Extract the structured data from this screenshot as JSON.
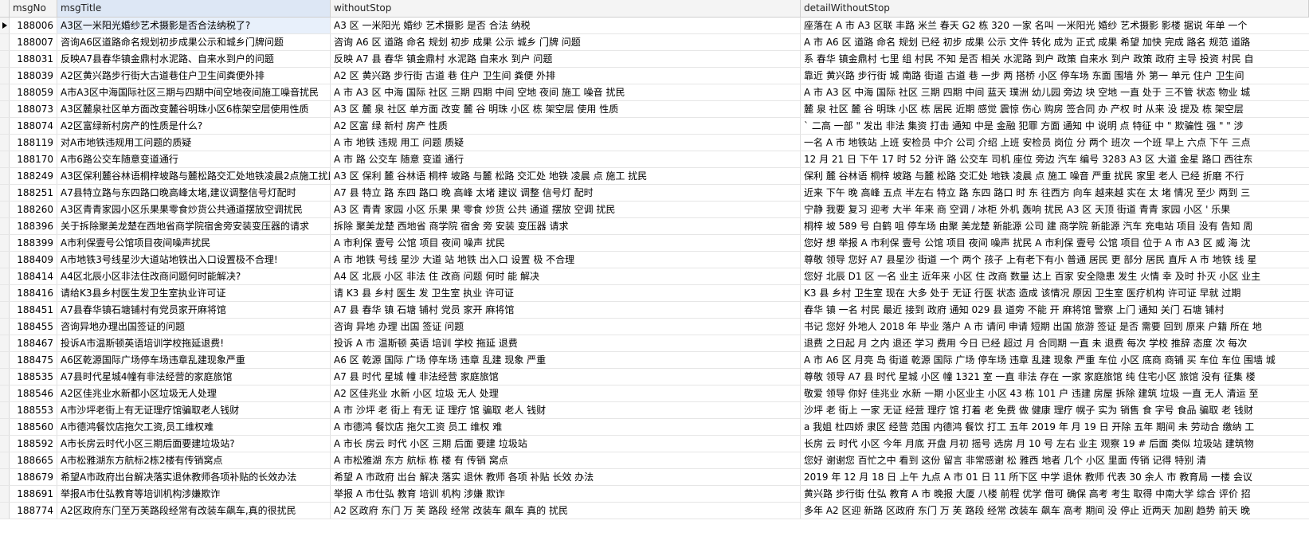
{
  "columns": [
    "msgNo",
    "msgTitle",
    "withoutStop",
    "detailWithoutStop"
  ],
  "rows": [
    {
      "no": "188006",
      "title": "A3区一米阳光婚纱艺术摄影是否合法纳税了?",
      "ws": "A3 区 一米阳光 婚纱 艺术摄影 是否 合法 纳税",
      "detail": "座落在 A 市 A3 区联 丰路 米兰 春天 G2 栋 320 一家 名叫 一米阳光 婚纱 艺术摄影 影楼 据说 年单 一个"
    },
    {
      "no": "188007",
      "title": "咨询A6区道路命名规划初步成果公示和城乡门牌问题",
      "ws": "咨询 A6 区 道路 命名 规划 初步 成果 公示 城乡 门牌 问题",
      "detail": "A 市 A6 区 道路 命名 规划 已经 初步 成果 公示 文件 转化 成为 正式 成果 希望 加快 完成 路名 规范 道路"
    },
    {
      "no": "188031",
      "title": "反映A7县春华镇金鼎村水泥路、自来水到户的问题",
      "ws": "反映 A7 县 春华 镇金鼎村 水泥路 自来水 到户 问题",
      "detail": "系 春华 镇金鼎村 七里 组 村民 不知 是否 相关 水泥路 到户 政策 自来水 到户 政策 政府 主导 投资 村民 自"
    },
    {
      "no": "188039",
      "title": "A2区黄兴路步行街大古道巷住户卫生间粪便外排",
      "ws": "A2 区 黄兴路 步行街 古道 巷 住户 卫生间 粪便 外排",
      "detail": "靠近 黄兴路 步行街 城 南路 街道 古道 巷 一步 两 搭桥 小区 停车场 东面 围墙 外 第一 单元 住户 卫生间"
    },
    {
      "no": "188059",
      "title": "A市A3区中海国际社区三期与四期中间空地夜间施工噪音扰民",
      "ws": "A 市 A3 区 中海 国际 社区 三期 四期 中间 空地 夜间 施工 噪音 扰民",
      "detail": "A 市 A3 区 中海 国际 社区 三期 四期 中间 蓝天 璞洲 幼儿园 旁边 块 空地 一直 处于 三不管 状态 物业 城"
    },
    {
      "no": "188073",
      "title": "A3区麓泉社区单方面改变麓谷明珠小区6栋架空层使用性质",
      "ws": "A3 区 麓 泉 社区 单方面 改变 麓 谷 明珠 小区 栋 架空层 使用 性质",
      "detail": "麓 泉 社区 麓 谷 明珠 小区 栋 居民 近期 感觉 震惊 伤心 购房 签合同 办 产权 时 从来 没 提及 栋 架空层"
    },
    {
      "no": "188074",
      "title": "A2区富绿新村房产的性质是什么?",
      "ws": "A2 区富 绿 新村 房产 性质",
      "detail": "` 二高 一部 \" 发出 非法 集资 打击 通知 中是 金融 犯罪 方面 通知 中 说明 点 特征 中 \" 欺骗性 强 \" \" 涉"
    },
    {
      "no": "188119",
      "title": "对A市地铁违规用工问题的质疑",
      "ws": "A 市 地铁 违规 用工 问题 质疑",
      "detail": "一名 A 市 地铁站 上班 安检员 中介 公司 介绍 上班 安检员 岗位 分 两个 班次 一个班 早上 六点 下午 三点"
    },
    {
      "no": "188170",
      "title": "A市6路公交车随意变道通行",
      "ws": "A 市 路 公交车 随意 变道 通行",
      "detail": "12 月 21 日 下午 17 时 52 分许 路 公交车 司机 座位 旁边 汽车 编号 3283 A3 区 大道 金星 路口 西往东"
    },
    {
      "no": "188249",
      "title": "A3区保利麓谷林语桐梓坡路与麓松路交汇处地铁凌晨2点施工扰民",
      "ws": "A3 区 保利 麓 谷林语 桐梓 坡路 与麓 松路 交汇处 地铁 凌晨 点 施工 扰民",
      "detail": "保利 麓 谷林语 桐梓 坡路 与麓 松路 交汇处 地铁 凌晨 点 施工 噪音 严重 扰民 家里 老人 已经 折磨 不行"
    },
    {
      "no": "188251",
      "title": "A7县特立路与东四路口晚高峰太堵,建议调整信号灯配时",
      "ws": "A7 县 特立 路 东四 路口 晚 高峰 太堵 建议 调整 信号灯 配时",
      "detail": "近来 下午 晚 高峰 五点 半左右 特立 路 东四 路口 时 东 往西方 向车 越来越 实在 太 堵 情况 至少 两到 三"
    },
    {
      "no": "188260",
      "title": "A3区青青家园小区乐果果零食炒货公共通道摆放空调扰民",
      "ws": "A3 区 青青 家园 小区 乐果 果 零食 炒货 公共 通道 摆放 空调 扰民",
      "detail": "宁静 我要 复习 迎考 大半 年来 商 空调 / 冰柜 外机 轰响 扰民 A3 区 天顶 街道 青青 家园 小区 ' 乐果"
    },
    {
      "no": "188396",
      "title": "关于拆除聚美龙楚在西地省商学院宿舍旁安装变压器的请求",
      "ws": "拆除 聚美龙楚 西地省 商学院 宿舍 旁 安装 变压器 请求",
      "detail": "桐梓 坡 589 号 白鹤 咀 停车场 由聚 美龙楚 新能源 公司 建 商学院 新能源 汽车 充电站 项目 没有 告知 周"
    },
    {
      "no": "188399",
      "title": "A市利保壹号公馆项目夜间噪声扰民",
      "ws": "A 市利保 壹号 公馆 项目 夜间 噪声 扰民",
      "detail": "您好 想 举报 A 市利保 壹号 公馆 项目 夜间 噪声 扰民 A 市利保 壹号 公馆 项目 位于 A 市 A3 区 威 海 沈"
    },
    {
      "no": "188409",
      "title": "A市地铁3号线星沙大道站地铁出入口设置极不合理!",
      "ws": "A 市 地铁 号线 星沙 大道 站 地铁 出入口 设置 极 不合理",
      "detail": "尊敬 领导 您好 A7 县星沙 街道 一个 两个 孩子 上有老下有小 普通 居民 更 部分 居民 直斥 A 市 地铁 线 星"
    },
    {
      "no": "188414",
      "title": "A4区北辰小区非法住改商问题何时能解决?",
      "ws": "A4 区 北辰 小区 非法 住 改商 问题 何时 能 解决",
      "detail": "您好 北辰 D1 区 一名 业主 近年来 小区 住 改商 数量 达上 百家 安全隐患 发生 火情 幸 及时 扑灭 小区 业主"
    },
    {
      "no": "188416",
      "title": "请给K3县乡村医生发卫生室执业许可证",
      "ws": "请 K3 县 乡村 医生 发 卫生室 执业 许可证",
      "detail": "K3 县 乡村 卫生室 现在 大多 处于 无证 行医 状态 造成 该情况 原因 卫生室 医疗机构 许可证 早就 过期"
    },
    {
      "no": "188451",
      "title": "A7县春华镇石塘铺村有党员家开麻将馆",
      "ws": "A7 县 春华 镇 石塘 铺村 党员 家开 麻将馆",
      "detail": "春华 镇 一名 村民 最近 接到 政府 通知 029 县 道旁 不能 开 麻将馆 警察 上门 通知 关门 石塘 铺村"
    },
    {
      "no": "188455",
      "title": "咨询异地办理出国签证的问题",
      "ws": "咨询 异地 办理 出国 签证 问题",
      "detail": "书记 您好 外地人 2018 年 毕业 落户 A 市 请问 申请 短期 出国 旅游 签证 是否 需要 回到 原来 户籍 所在 地"
    },
    {
      "no": "188467",
      "title": "投诉A市温斯顿英语培训学校拖延退费!",
      "ws": "投诉 A 市 温斯顿 英语 培训 学校 拖延 退费",
      "detail": "退费 之日起 月 之内 退还 学习 费用 今日 已经 超过 月 合同期 一直 未 退费 每次 学校 推辞 态度 次 每次"
    },
    {
      "no": "188475",
      "title": "A6区乾源国际广场停车场违章乱建现象严重",
      "ws": "A6 区 乾源 国际 广场 停车场 违章 乱建 现象 严重",
      "detail": "A 市 A6 区 月亮 岛 街道 乾源 国际 广场 停车场 违章 乱建 现象 严重 车位 小区 底商 商铺 买 车位 车位 围墙 城"
    },
    {
      "no": "188535",
      "title": "A7县时代星城4幢有非法经营的家庭旅馆",
      "ws": "A7 县 时代 星城 幢 非法经营 家庭旅馆",
      "detail": "尊敬 领导 A7 县 时代 星城 小区 幢 1321 室 一直 非法 存在 一家 家庭旅馆 纯 住宅小区 旅馆 没有 征集 楼"
    },
    {
      "no": "188546",
      "title": "A2区佳兆业水新都小区垃圾无人处理",
      "ws": "A2 区佳兆业 水新 小区 垃圾 无人 处理",
      "detail": "敬爱 领导 你好 佳兆业 水新 一期 小区业主 小区 43 栋 101 户 违建 房屋 拆除 建筑 垃圾 一直 无人 清运 至"
    },
    {
      "no": "188553",
      "title": "A市沙坪老街上有无证理疗馆骗取老人钱财",
      "ws": "A 市 沙坪 老 街上 有无 证 理疗 馆 骗取 老人 钱财",
      "detail": "沙坪 老 街上 一家 无证 经营 理疗 馆 打着 老 免费 做 健康 理疗 幌子 实为 销售 食 字号 食品 骗取 老 钱财"
    },
    {
      "no": "188560",
      "title": "A市德鸿餐饮店拖欠工资,员工维权难",
      "ws": "A 市德鸿 餐饮店 拖欠工资 员工 维权 难",
      "detail": "a 我姐 杜四娇 隶区 经营 范围 内德鸿 餐饮 打工 五年 2019 年 月 19 日 开除 五年 期间 未 劳动合 缴纳 工"
    },
    {
      "no": "188592",
      "title": "A市长房云时代小区三期后面要建垃圾站?",
      "ws": "A 市长 房云 时代 小区 三期 后面 要建 垃圾站",
      "detail": "长房 云 时代 小区 今年 月底 开盘 月初 摇号 选房 月 10 号 左右 业主 观察 19 # 后面 类似 垃圾站 建筑物"
    },
    {
      "no": "188665",
      "title": "A市松雅湖东方航标2栋2楼有传销窝点",
      "ws": "A 市松雅湖 东方 航标 栋 楼 有 传销 窝点",
      "detail": "您好   谢谢您 百忙之中 看到 这份 留言   非常感谢      松 雅西 地者 几个 小区 里面 传销   记得 特别 清"
    },
    {
      "no": "188679",
      "title": "希望A市政府出台解决落实退休教师各项补贴的长效办法",
      "ws": "希望 A 市政府 出台 解决 落实 退休 教师 各项 补贴 长效 办法",
      "detail": "2019 年 12 月 18 日 上午 九点 A 市 01 日 11 所下区 中学 退休 教师 代表 30 余人 市 教育局 一楼 会议"
    },
    {
      "no": "188691",
      "title": "举报A市仕弘教育等培训机构涉嫌欺诈",
      "ws": "举报 A 市仕弘 教育 培训 机构 涉嫌 欺诈",
      "detail": "黄兴路 步行街 仕弘 教育 A 市 晚报 大厦 八楼 前程 优学 借可 确保 高考 考生 取得 中南大学 综合 评价 招"
    },
    {
      "no": "188774",
      "title": "A2区政府东门至万芙路段经常有改装车飙车,真的很扰民",
      "ws": "A2 区政府 东门 万 芙 路段 经常 改装车 飙车 真的 扰民",
      "detail": "多年 A2 区迎 新路 区政府 东门 万 芙 路段 经常 改装车 飙车 高考 期间 没 停止 近两天 加剧 趋势 前天 晚"
    }
  ]
}
